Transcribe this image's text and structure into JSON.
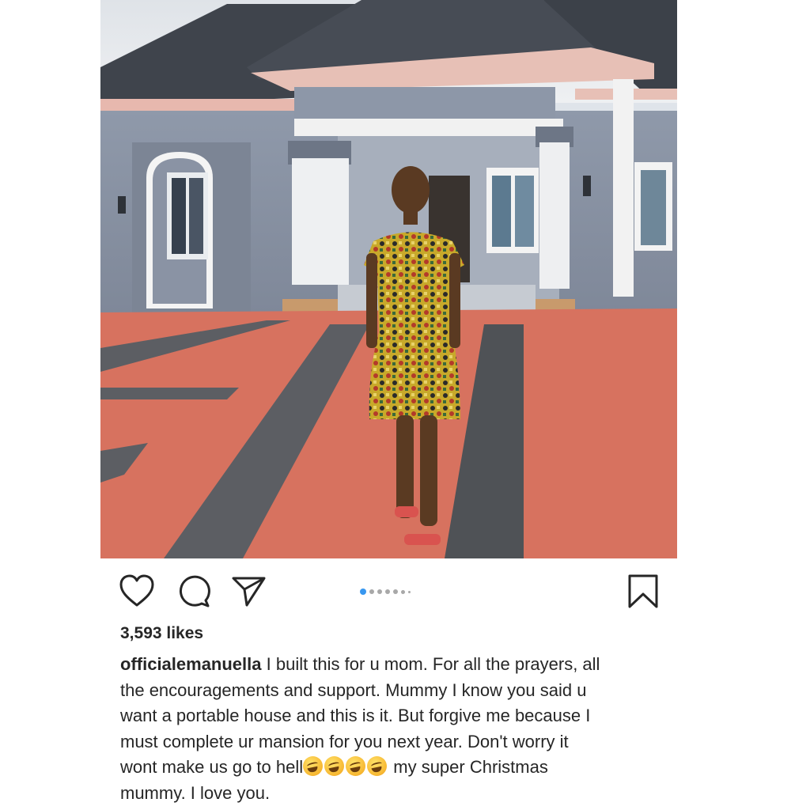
{
  "post": {
    "likes": "3,593 likes",
    "username": "officialemanuella",
    "caption_line1": " I built this for u mom. For all the prayers, all",
    "caption_line2": "the encouragements and support. Mummy I know you said u",
    "caption_line3": "want a portable house and this is it. But forgive me because I",
    "caption_line4": "must complete ur mansion for you next year. Don't worry it",
    "caption_line5a": "wont make us go to hell",
    "caption_line5b": " my super Christmas",
    "caption_line6": "mummy. I love you.",
    "emoji_name": "rolling-on-the-floor-laughing",
    "emoji_count": 4
  },
  "carousel": {
    "total_dots": 7,
    "active_index": 0
  },
  "icons": {
    "like": "heart-icon",
    "comment": "comment-icon",
    "share": "send-icon",
    "save": "bookmark-icon"
  },
  "colors": {
    "active_dot": "#3897f0",
    "inactive_dot": "#a8a8a8",
    "text": "#262626"
  }
}
